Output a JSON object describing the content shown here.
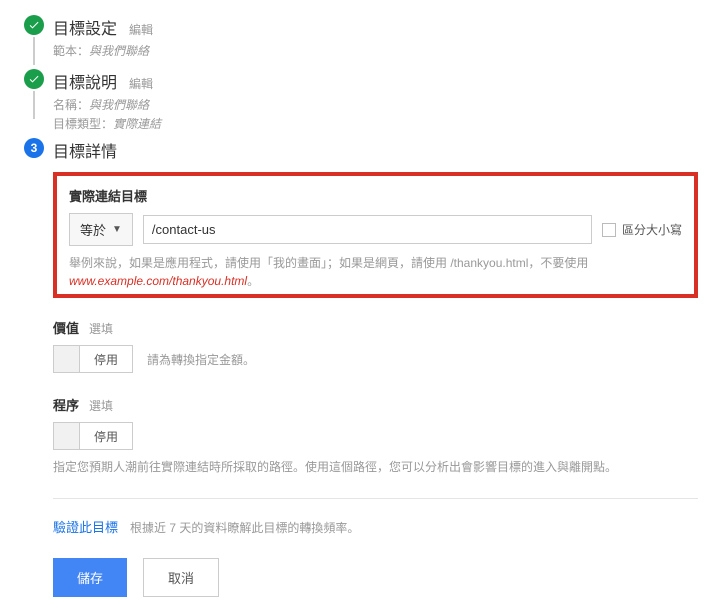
{
  "steps": {
    "setup": {
      "title": "目標設定",
      "edit": "編輯",
      "template_label": "範本：",
      "template_value": "與我們聯絡"
    },
    "description": {
      "title": "目標說明",
      "edit": "編輯",
      "name_label": "名稱：",
      "name_value": "與我們聯絡",
      "type_label": "目標類型：",
      "type_value": "實際連結"
    },
    "details": {
      "number": "3",
      "title": "目標詳情"
    }
  },
  "destination": {
    "label": "實際連結目標",
    "match_type": "等於",
    "value": "/contact-us",
    "case_sensitive": "區分大小寫",
    "help_prefix": "舉例來說，如果是應用程式，請使用「我的畫面」；如果是網頁，請使用 ",
    "help_code": "/thankyou.html",
    "help_mid": "，不要使用 ",
    "help_url": "www.example.com/thankyou.html",
    "help_suffix": "。"
  },
  "value": {
    "title": "價值",
    "optional": "選填",
    "toggle_off": "停用",
    "desc": "請為轉換指定金額。"
  },
  "funnel": {
    "title": "程序",
    "optional": "選填",
    "toggle_off": "停用",
    "help": "指定您預期人潮前往實際連結時所採取的路徑。使用這個路徑，您可以分析出會影響目標的進入與離開點。"
  },
  "verify": {
    "link": "驗證此目標",
    "desc": "根據近 7 天的資料瞭解此目標的轉換頻率。"
  },
  "actions": {
    "save": "儲存",
    "cancel": "取消"
  }
}
